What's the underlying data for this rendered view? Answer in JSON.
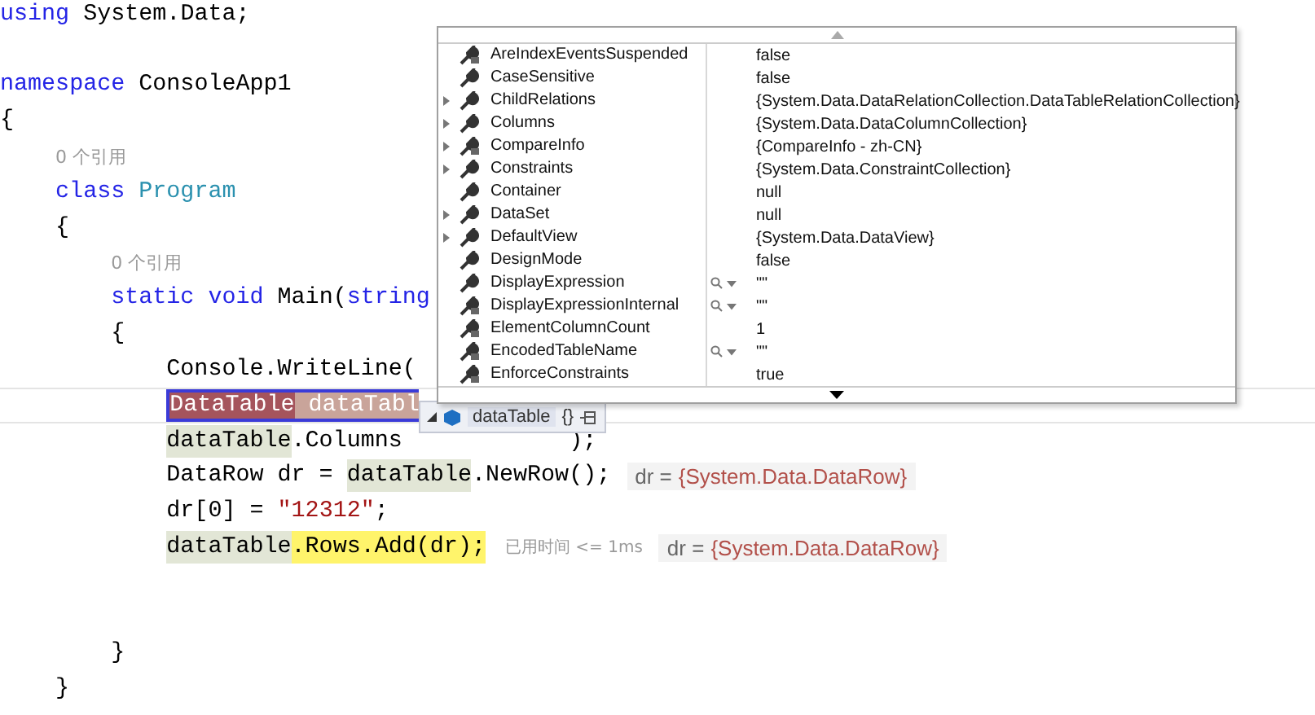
{
  "code_lines": [
    {
      "kind": "code",
      "tokens": [
        {
          "text": "using",
          "kind": "keyword"
        },
        {
          "text": " System.Data;",
          "kind": "plain"
        }
      ]
    },
    {
      "kind": "blank"
    },
    {
      "kind": "code",
      "tokens": [
        {
          "text": "namespace",
          "kind": "keyword"
        },
        {
          "text": " ConsoleApp1",
          "kind": "plain"
        }
      ]
    },
    {
      "kind": "open",
      "tokens": [
        {
          "text": "{",
          "kind": "plain"
        }
      ]
    },
    {
      "kind": "lens",
      "text": "0 个引用"
    },
    {
      "kind": "code",
      "tokens": [
        {
          "text": "class ",
          "kind": "keyword"
        },
        {
          "text": "Program",
          "kind": "type"
        }
      ]
    },
    {
      "kind": "open",
      "tokens": [
        {
          "text": "{",
          "kind": "plain"
        }
      ]
    },
    {
      "kind": "lens",
      "text": "0 个引用"
    },
    {
      "kind": "code",
      "tokens": [
        {
          "text": "static void",
          "kind": "keyword"
        },
        {
          "text": " Main(",
          "kind": "plain"
        },
        {
          "text": "string",
          "kind": "keyword"
        }
      ]
    },
    {
      "kind": "open",
      "tokens": [
        {
          "text": "{",
          "kind": "plain"
        }
      ]
    },
    {
      "kind": "code",
      "tokens": [
        {
          "text": "Console.WriteLine(",
          "kind": "plain"
        }
      ]
    },
    {
      "kind": "code",
      "selected": true,
      "tokens": [
        {
          "text": "DataTable",
          "kind": "decl-type"
        },
        {
          "text": " dataTabl",
          "kind": "decl-name"
        }
      ]
    },
    {
      "kind": "code",
      "tokens": [
        {
          "text": "dataTable",
          "kind": "ref"
        },
        {
          "text": ".Columns",
          "kind": "plain"
        },
        {
          "text": ");",
          "kind": "after-tip"
        }
      ]
    },
    {
      "kind": "code",
      "tokens": [
        {
          "text": "DataRow dr = ",
          "kind": "plain"
        },
        {
          "text": "dataTable",
          "kind": "ref"
        },
        {
          "text": ".NewRow();",
          "kind": "plain"
        }
      ],
      "hints": [
        {
          "kind": "value",
          "name": "dr =",
          "value": "{System.Data.DataRow}"
        }
      ]
    },
    {
      "kind": "code",
      "tokens": [
        {
          "text": "dr[0] = ",
          "kind": "plain"
        },
        {
          "text": "\"12312\"",
          "kind": "string"
        },
        {
          "text": ";",
          "kind": "plain"
        }
      ]
    },
    {
      "kind": "code",
      "tokens": [
        {
          "text": "dataTable",
          "kind": "ref"
        },
        {
          "text": ".Rows.Add(dr);",
          "kind": "current"
        }
      ],
      "hints": [
        {
          "kind": "elapsed",
          "text": "已用时间 <= 1ms"
        },
        {
          "kind": "value",
          "name": "dr =",
          "value": "{System.Data.DataRow}"
        }
      ]
    },
    {
      "kind": "blank"
    },
    {
      "kind": "blank"
    },
    {
      "kind": "close",
      "tokens": [
        {
          "text": "}",
          "kind": "plain"
        }
      ]
    },
    {
      "kind": "close",
      "tokens": [
        {
          "text": "}",
          "kind": "plain"
        }
      ]
    }
  ],
  "datatip": {
    "label": "dataTable",
    "braces": "{}"
  },
  "watch_popup": {
    "rows": [
      {
        "name": "AreIndexEventsSuspended",
        "value": "false",
        "expandable": false,
        "kind": "private",
        "visualizer": false
      },
      {
        "name": "CaseSensitive",
        "value": "false",
        "expandable": false,
        "kind": "public",
        "visualizer": false
      },
      {
        "name": "ChildRelations",
        "value": "{System.Data.DataRelationCollection.DataTableRelationCollection}",
        "expandable": true,
        "kind": "public",
        "visualizer": false
      },
      {
        "name": "Columns",
        "value": "{System.Data.DataColumnCollection}",
        "expandable": true,
        "kind": "public",
        "visualizer": false
      },
      {
        "name": "CompareInfo",
        "value": "{CompareInfo - zh-CN}",
        "expandable": true,
        "kind": "private",
        "visualizer": false
      },
      {
        "name": "Constraints",
        "value": "{System.Data.ConstraintCollection}",
        "expandable": true,
        "kind": "public",
        "visualizer": false
      },
      {
        "name": "Container",
        "value": "null",
        "expandable": false,
        "kind": "public",
        "visualizer": false
      },
      {
        "name": "DataSet",
        "value": "null",
        "expandable": true,
        "kind": "public",
        "visualizer": false
      },
      {
        "name": "DefaultView",
        "value": "{System.Data.DataView}",
        "expandable": true,
        "kind": "public",
        "visualizer": false
      },
      {
        "name": "DesignMode",
        "value": "false",
        "expandable": false,
        "kind": "public",
        "visualizer": false
      },
      {
        "name": "DisplayExpression",
        "value": "\"\"",
        "expandable": false,
        "kind": "public",
        "visualizer": true
      },
      {
        "name": "DisplayExpressionInternal",
        "value": "\"\"",
        "expandable": false,
        "kind": "private",
        "visualizer": true
      },
      {
        "name": "ElementColumnCount",
        "value": "1",
        "expandable": false,
        "kind": "private",
        "visualizer": false
      },
      {
        "name": "EncodedTableName",
        "value": "\"\"",
        "expandable": false,
        "kind": "private",
        "visualizer": true
      },
      {
        "name": "EnforceConstraints",
        "value": "true",
        "expandable": false,
        "kind": "private",
        "visualizer": false
      }
    ]
  }
}
